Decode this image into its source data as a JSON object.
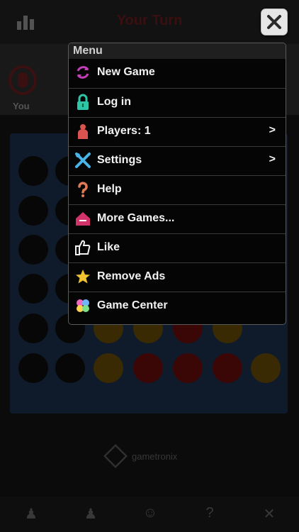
{
  "header": {
    "title": "Your Turn"
  },
  "player": {
    "label": "You"
  },
  "brand": {
    "name": "gametronix"
  },
  "menu": {
    "title": "Menu",
    "items": [
      {
        "label": "New Game",
        "icon": "refresh-icon",
        "arrow": ""
      },
      {
        "label": "Log in",
        "icon": "lock-icon",
        "arrow": ""
      },
      {
        "label": "Players: 1",
        "icon": "person-icon",
        "arrow": ">"
      },
      {
        "label": "Settings",
        "icon": "tools-icon",
        "arrow": ">"
      },
      {
        "label": "Help",
        "icon": "question-icon",
        "arrow": ""
      },
      {
        "label": "More Games...",
        "icon": "more-games-icon",
        "arrow": ""
      },
      {
        "label": "Like",
        "icon": "thumbs-up-icon",
        "arrow": ""
      },
      {
        "label": "Remove Ads",
        "icon": "star-icon",
        "arrow": ""
      },
      {
        "label": "Game Center",
        "icon": "game-center-icon",
        "arrow": ""
      }
    ]
  },
  "colors": {
    "menu_bg": "#050505",
    "menu_text": "#f2f2f2",
    "close_bg": "#e6e6e6"
  }
}
